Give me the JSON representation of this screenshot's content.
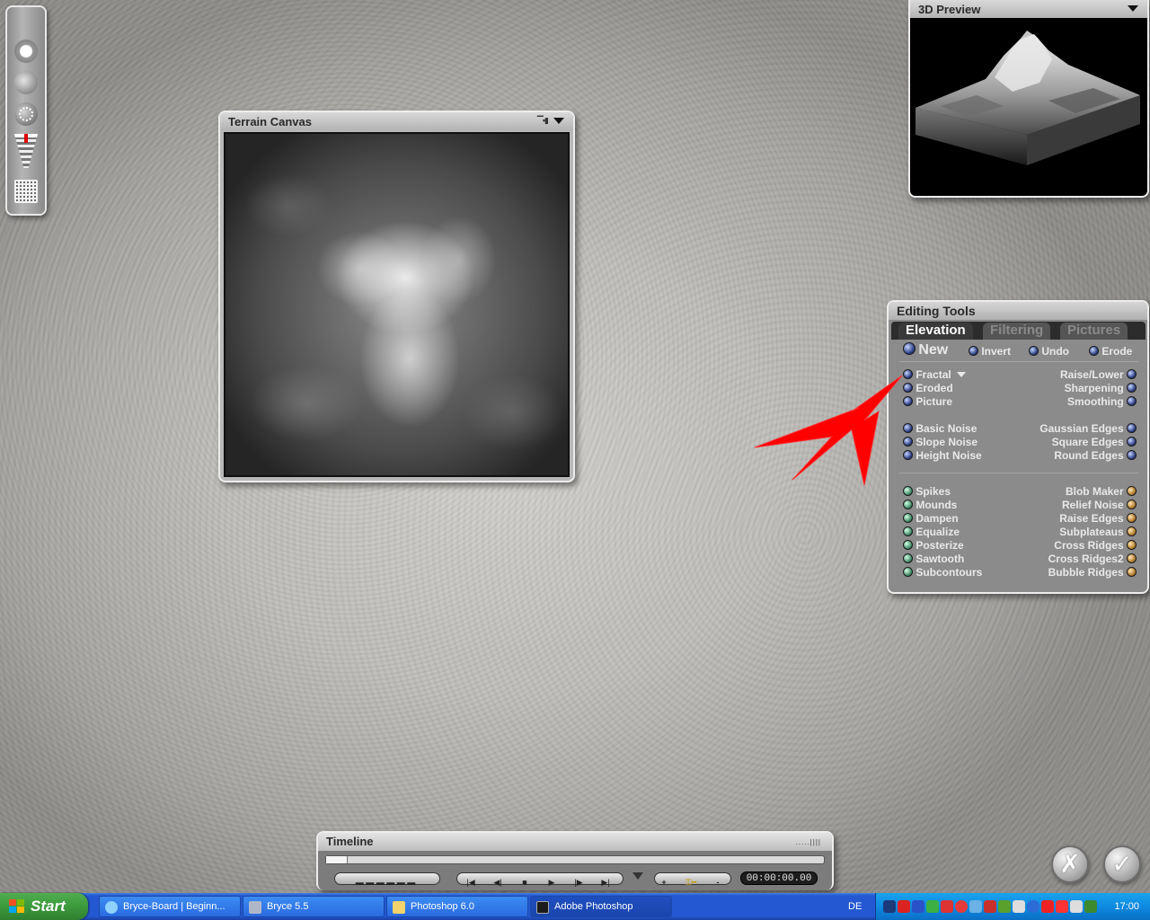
{
  "toolstrip": {
    "tools": [
      "sphere-brush-icon",
      "soft-brush-icon",
      "dotted-brush-icon",
      "elevation-slider-icon",
      "grid-resolution-icon"
    ]
  },
  "terrain_canvas": {
    "title": "Terrain Canvas"
  },
  "preview": {
    "title": "3D Preview"
  },
  "editing_tools": {
    "title": "Editing Tools",
    "tabs": [
      {
        "label": "Elevation",
        "active": true
      },
      {
        "label": "Filtering",
        "active": false
      },
      {
        "label": "Pictures",
        "active": false
      }
    ],
    "top_row": [
      "New",
      "Invert",
      "Undo",
      "Erode"
    ],
    "group1_left": [
      "Fractal",
      "Eroded",
      "Picture"
    ],
    "group1_right": [
      "Raise/Lower",
      "Sharpening",
      "Smoothing"
    ],
    "group2_left": [
      "Basic Noise",
      "Slope Noise",
      "Height Noise"
    ],
    "group2_right": [
      "Gaussian Edges",
      "Square Edges",
      "Round Edges"
    ],
    "group3_left": [
      "Spikes",
      "Mounds",
      "Dampen",
      "Equalize",
      "Posterize",
      "Sawtooth",
      "Subcontours"
    ],
    "group3_right": [
      "Blob Maker",
      "Relief Noise",
      "Raise Edges",
      "Subplateaus",
      "Cross Ridges",
      "Cross Ridges2",
      "Bubble Ridges"
    ]
  },
  "timeline": {
    "title": "Timeline",
    "time": "00:00:00.00",
    "transport": [
      "skip-start-icon",
      "step-back-icon",
      "stop-icon",
      "play-icon",
      "step-forward-icon",
      "skip-end-icon"
    ],
    "key_controls": [
      "+",
      "-"
    ]
  },
  "dialog_buttons": {
    "cancel": "✗",
    "confirm": "✓"
  },
  "taskbar": {
    "start_label": "Start",
    "tasks": [
      {
        "label": "Bryce-Board | Beginn...",
        "icon": "ie-icon"
      },
      {
        "label": "Bryce 5.5",
        "icon": "bryce-icon"
      },
      {
        "label": "Photoshop 6.0",
        "icon": "folder-icon"
      },
      {
        "label": "Adobe Photoshop",
        "icon": "photoshop-icon"
      }
    ],
    "language": "DE",
    "clock": "17:00"
  },
  "colors": {
    "taskbar_blue": "#2458d2",
    "start_green": "#3c9a3c",
    "arrow_red": "#ff0000"
  }
}
